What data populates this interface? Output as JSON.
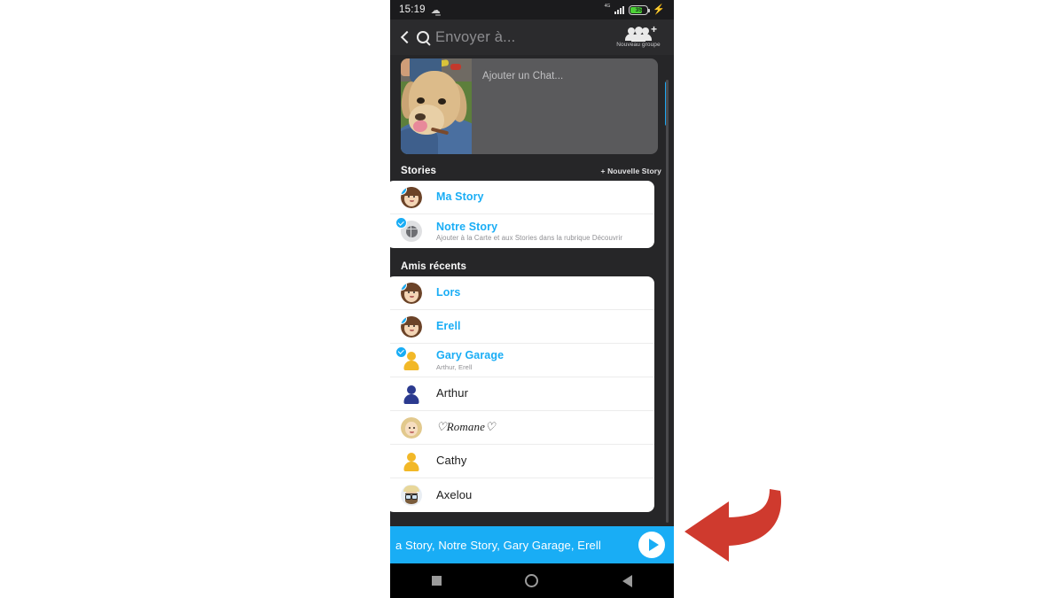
{
  "status_bar": {
    "time": "15:19",
    "mute_icon": "bell-off-icon",
    "network_label": "4G",
    "battery_level": "35",
    "battery_color": "#4cd137",
    "charging_icon": "bolt-icon"
  },
  "header": {
    "back_icon": "chevron-left-icon",
    "search_icon": "search-icon",
    "search_placeholder": "Envoyer à...",
    "new_group_icon": "group-add-icon",
    "new_group_label": "Nouveau groupe"
  },
  "chat_preview": {
    "thumbnail_alt": "dog-photo-thumbnail",
    "placeholder": "Ajouter un Chat..."
  },
  "stories_section": {
    "title": "Stories",
    "action_label": "+ Nouvelle Story",
    "items": [
      {
        "name": "Ma Story",
        "subtitle": "",
        "selected": true,
        "avatar": "bitmoji-female-brown-hair"
      },
      {
        "name": "Notre Story",
        "subtitle": "Ajouter à la Carte et aux Stories dans la rubrique Découvrir",
        "selected": true,
        "avatar": "globe-icon"
      }
    ]
  },
  "friends_section": {
    "title": "Amis récents",
    "items": [
      {
        "name": "Lors",
        "subtitle": "",
        "selected": true,
        "avatar": "bitmoji-female-brown-hair"
      },
      {
        "name": "Erell",
        "subtitle": "",
        "selected": true,
        "avatar": "bitmoji-female-brown-hair"
      },
      {
        "name": "Gary Garage",
        "subtitle": "Arthur, Erell",
        "selected": true,
        "avatar": "silhouette-yellow"
      },
      {
        "name": "Arthur",
        "subtitle": "",
        "selected": false,
        "avatar": "silhouette-blue"
      },
      {
        "name": "♡Romane♡",
        "subtitle": "",
        "selected": false,
        "avatar": "bitmoji-blonde"
      },
      {
        "name": "Cathy",
        "subtitle": "",
        "selected": false,
        "avatar": "silhouette-yellow"
      },
      {
        "name": "Axelou",
        "subtitle": "",
        "selected": false,
        "avatar": "bitmoji-beard-glasses"
      }
    ]
  },
  "send_bar": {
    "recipients_text": "a Story, Notre Story, Gary Garage, Erell",
    "send_icon": "send-arrow-icon",
    "accent_color": "#19adf5"
  },
  "android_nav": {
    "recents_icon": "square-icon",
    "home_icon": "circle-icon",
    "back_icon": "triangle-back-icon"
  },
  "annotation": {
    "arrow_icon": "curved-arrow-left-icon",
    "arrow_color": "#cf3a2e"
  }
}
